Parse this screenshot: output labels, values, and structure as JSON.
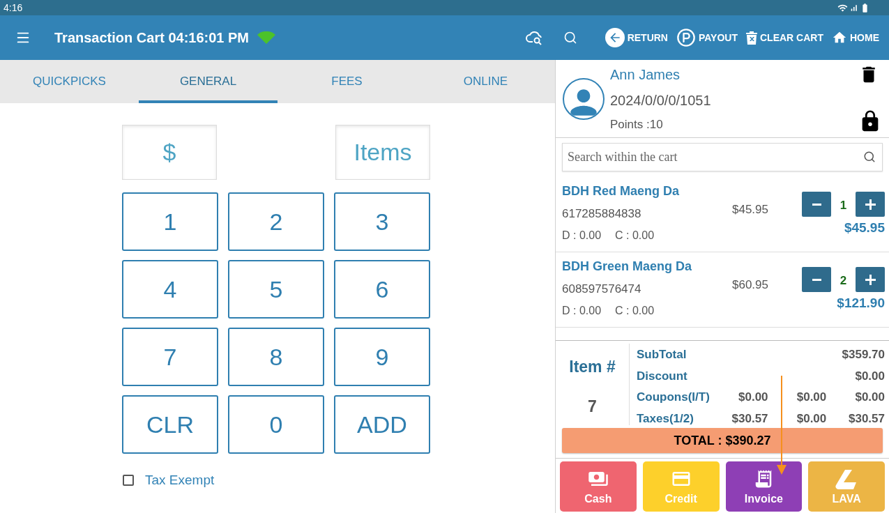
{
  "status_bar": {
    "time": "4:16"
  },
  "header": {
    "title": "Transaction Cart 04:16:01 PM",
    "actions": [
      {
        "label": "RETURN",
        "kind": "return"
      },
      {
        "label": "PAYOUT",
        "kind": "payout"
      },
      {
        "label": "CLEAR CART",
        "kind": "clear"
      },
      {
        "label": "HOME",
        "kind": "home"
      }
    ]
  },
  "tabs": [
    {
      "label": "QUICKPICKS",
      "selected": false
    },
    {
      "label": "GENERAL",
      "selected": true
    },
    {
      "label": "FEES",
      "selected": false
    },
    {
      "label": "ONLINE",
      "selected": false
    }
  ],
  "keypad": {
    "amount_label": "$",
    "items_label": "Items",
    "keys": [
      "1",
      "2",
      "3",
      "4",
      "5",
      "6",
      "7",
      "8",
      "9",
      "CLR",
      "0",
      "ADD"
    ]
  },
  "tax_exempt": {
    "label": "Tax Exempt",
    "checked": false
  },
  "customer": {
    "name": "Ann James",
    "id": "2024/0/0/0/1051",
    "points": "Points :10"
  },
  "cart_search": {
    "placeholder": "Search within the cart"
  },
  "cart_items": [
    {
      "name": "BDH Red Maeng Da",
      "sku": "617285884838",
      "price": "$45.95",
      "qty": "1",
      "total": "$45.95",
      "discount": "D : 0.00",
      "coupon": "C : 0.00"
    },
    {
      "name": "BDH Green Maeng Da",
      "sku": "608597576474",
      "price": "$60.95",
      "qty": "2",
      "total": "$121.90",
      "discount": "D : 0.00",
      "coupon": "C : 0.00"
    }
  ],
  "summary": {
    "count_label": "Item #",
    "count": "7",
    "rows": [
      {
        "label": "SubTotal",
        "values": [
          "$359.70"
        ]
      },
      {
        "label": "Discount",
        "values": [
          "$0.00"
        ]
      },
      {
        "label": "Coupons(I/T)",
        "values": [
          "$0.00",
          "$0.00",
          "$0.00"
        ]
      },
      {
        "label": "Taxes(1/2)",
        "values": [
          "$30.57",
          "$0.00",
          "$30.57"
        ]
      }
    ],
    "total": "TOTAL : $390.27"
  },
  "payments": [
    {
      "label": "Cash",
      "kind": "cash",
      "color": "#ef6570"
    },
    {
      "label": "Credit",
      "kind": "credit",
      "color": "#fdd02b"
    },
    {
      "label": "Invoice",
      "kind": "invoice",
      "color": "#8e3fb5"
    },
    {
      "label": "LAVA",
      "kind": "lava",
      "color": "#ecb545"
    }
  ]
}
